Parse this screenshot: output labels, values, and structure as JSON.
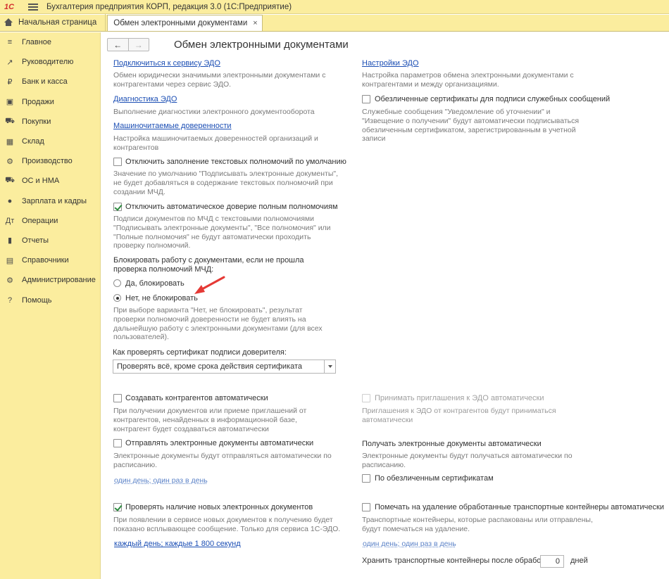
{
  "window": {
    "title": "Бухгалтерия предприятия КОРП, редакция 3.0  (1С:Предприятие)",
    "logo_text": "1С"
  },
  "tabs": {
    "home_label": "Начальная страница",
    "active_label": "Обмен электронными документами",
    "close_glyph": "×"
  },
  "sidebar": {
    "items": [
      {
        "label": "Главное",
        "icon": "≡",
        "icon_name": "menu-lines-icon"
      },
      {
        "label": "Руководителю",
        "icon": "↗",
        "icon_name": "trend-up-icon"
      },
      {
        "label": "Банк и касса",
        "icon": "₽",
        "icon_name": "ruble-coin-icon"
      },
      {
        "label": "Продажи",
        "icon": "▣",
        "icon_name": "shopping-bag-icon"
      },
      {
        "label": "Покупки",
        "icon": "⛟",
        "icon_name": "cart-icon"
      },
      {
        "label": "Склад",
        "icon": "▦",
        "icon_name": "warehouse-grid-icon"
      },
      {
        "label": "Производство",
        "icon": "⚙",
        "icon_name": "production-gear-icon"
      },
      {
        "label": "ОС и НМА",
        "icon": "⛟",
        "icon_name": "truck-icon"
      },
      {
        "label": "Зарплата и кадры",
        "icon": "●",
        "icon_name": "person-icon"
      },
      {
        "label": "Операции",
        "icon": "Дт",
        "icon_name": "debit-credit-icon"
      },
      {
        "label": "Отчеты",
        "icon": "▮",
        "icon_name": "bar-chart-icon"
      },
      {
        "label": "Справочники",
        "icon": "▤",
        "icon_name": "book-icon"
      },
      {
        "label": "Администрирование",
        "icon": "⚙",
        "icon_name": "settings-gear-icon"
      },
      {
        "label": "Помощь",
        "icon": "?",
        "icon_name": "help-question-icon"
      }
    ]
  },
  "nav": {
    "back": "←",
    "forward": "→"
  },
  "page": {
    "title": "Обмен электронными документами"
  },
  "left": {
    "connect_link": "Подключиться к сервису ЭДО",
    "connect_desc": "Обмен юридически значимыми электронными документами с контрагентами через сервис ЭДО.",
    "diag_link": "Диагностика ЭДО",
    "diag_desc": "Выполнение диагностики электронного документооборота",
    "mcd_link": "Машиночитаемые доверенности",
    "mcd_desc": "Настройка машиночитаемых доверенностей организаций и контрагентов",
    "disable_text_fill_label": "Отключить заполнение текстовых полномочий по умолчанию",
    "disable_text_fill_desc": "Значение по умолчанию \"Подписывать электронные документы\", не будет добавляться в содержание текстовых полномочий при создании МЧД.",
    "disable_auto_trust_label": "Отключить автоматическое доверие полным полномочиям",
    "disable_auto_trust_desc": "Подписи документов по МЧД с текстовыми полномочиями \"Подписывать электронные документы\", \"Все полномочия\" или \"Полные полномочия\" не будут автоматически проходить проверку полномочий.",
    "block_question": "Блокировать работу с документами, если не прошла проверка полномочий МЧД:",
    "radio_yes": "Да, блокировать",
    "radio_no": "Нет, не блокировать",
    "radio_no_desc": "При выборе варианта \"Нет, не блокировать\", результат проверки полномочий доверенности не будет влиять на дальнейшую работу с электронными документами (для всех пользователей).",
    "cert_check_label": "Как проверять сертификат подписи доверителя:",
    "cert_check_value": "Проверять всё, кроме срока действия сертификата",
    "create_counterparties_label": "Создавать контрагентов автоматически",
    "create_counterparties_desc": "При получении документов или приеме приглашений от контрагентов, ненайденных в информационной базе, контрагент будет создаваться автоматически",
    "send_auto_label": "Отправлять электронные документы автоматически",
    "send_auto_desc": "Электронные документы будут отправляться автоматически по расписанию.",
    "send_schedule_link": "один день; один раз в день",
    "check_new_label": "Проверять наличие новых электронных документов",
    "check_new_desc": "При появлении в сервисе новых документов к получению будет показано всплывающее сообщение. Только для сервиса 1С-ЭДО.",
    "check_schedule_link": "каждый день; каждые 1 800 секунд"
  },
  "right": {
    "settings_link": "Настройки ЭДО",
    "settings_desc": "Настройка параметров обмена электронными документами с контрагентами и между организациями.",
    "impersonal_certs_label": "Обезличенные сертификаты для подписи служебных сообщений",
    "impersonal_certs_desc": "Служебные сообщения \"Уведомление об уточнении\" и \"Извещение о получении\" будут автоматически подписываться обезличенным сертификатом, зарегистрированным в учетной записи",
    "accept_invites_label": "Принимать приглашения к ЭДО автоматически",
    "accept_invites_desc": "Приглашения к ЭДО от контрагентов будут приниматься автоматически",
    "receive_auto_heading": "Получать электронные документы автоматически",
    "receive_auto_desc": "Электронные документы будут получаться автоматически по расписанию.",
    "by_impersonal_label": "По обезличенным сертификатам",
    "mark_delete_label": "Помечать на удаление обработанные транспортные контейнеры автоматически",
    "mark_delete_desc": "Транспортные контейнеры, которые распакованы или отправлены, будут помечаться на удаление.",
    "mark_schedule_link": "один день; один раз в день",
    "keep_label": "Хранить транспортные контейнеры после обработки:",
    "keep_value": "0",
    "keep_unit": "дней"
  },
  "colors": {
    "accent_link": "#1b4eb4",
    "sidebar_bg": "#fbed9e",
    "arrow": "#e53935",
    "check": "#2b8a3e"
  }
}
